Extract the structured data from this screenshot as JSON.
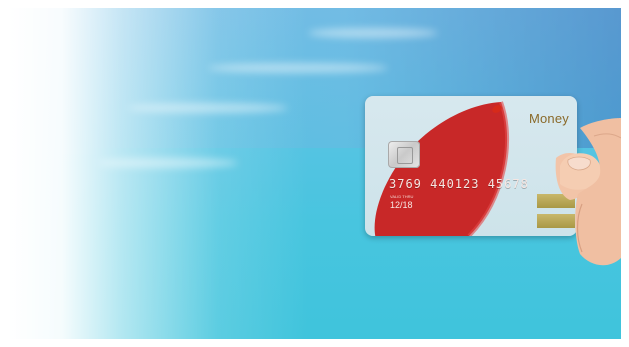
{
  "card": {
    "brand": "Money",
    "number": "3769 440123 45678",
    "valid_label": "VALID THRU",
    "expiry": "12/18"
  },
  "colors": {
    "sky": "#58c3e3",
    "card_red": "#c82828",
    "card_base": "#d7e8ee",
    "brand_text": "#8a6a2a"
  }
}
